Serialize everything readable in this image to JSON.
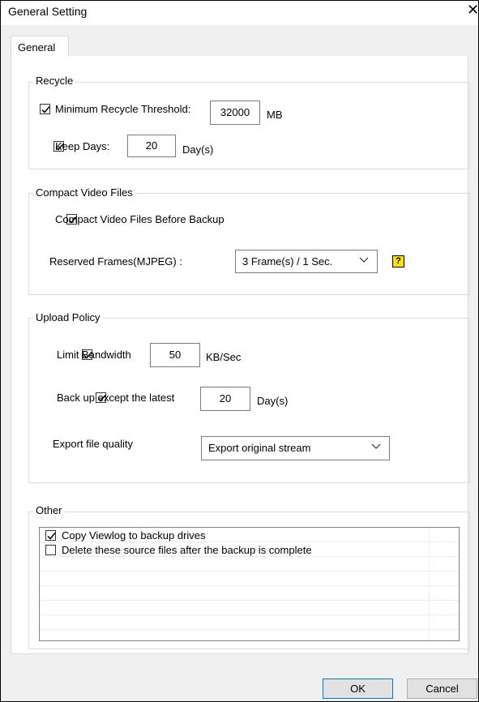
{
  "window": {
    "title": "General Setting",
    "close_glyph": "✕"
  },
  "tabs": [
    {
      "label": "General"
    }
  ],
  "recycle": {
    "group_label": "Recycle",
    "min_threshold": {
      "label": "Minimum Recycle Threshold:",
      "checked": true,
      "value": "32000",
      "unit": "MB"
    },
    "keep_days": {
      "label": "Keep Days:",
      "checked": true,
      "value": "20",
      "unit": "Day(s)"
    }
  },
  "compact": {
    "group_label": "Compact Video Files",
    "before_backup": {
      "label": "Compact Video Files Before Backup",
      "checked": true
    },
    "reserved_frames": {
      "label": "Reserved Frames(MJPEG) :",
      "selected": "3 Frame(s) / 1 Sec.",
      "help_glyph": "?"
    }
  },
  "upload": {
    "group_label": "Upload Policy",
    "limit_bandwidth": {
      "label": "Limit Bandwidth",
      "checked": true,
      "value": "50",
      "unit": "KB/Sec"
    },
    "backup_except": {
      "label": "Back up except the latest",
      "checked": true,
      "value": "20",
      "unit": "Day(s)"
    },
    "export_quality": {
      "label": "Export file quality",
      "selected": "Export original stream"
    }
  },
  "other": {
    "group_label": "Other",
    "items": [
      {
        "label": "Copy Viewlog to backup drives",
        "checked": true
      },
      {
        "label": "Delete these source files after the backup is complete",
        "checked": false
      }
    ]
  },
  "buttons": {
    "ok": "OK",
    "cancel": "Cancel"
  }
}
